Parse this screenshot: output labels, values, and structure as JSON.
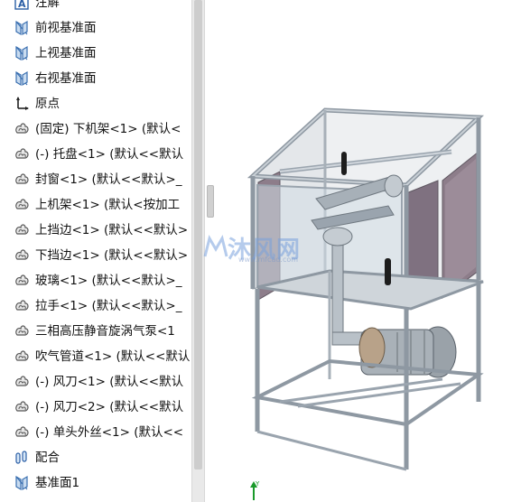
{
  "feature_tree": {
    "items": [
      {
        "icon": "annotations-icon",
        "label": "注解"
      },
      {
        "icon": "plane-icon",
        "label": "前视基准面"
      },
      {
        "icon": "plane-icon",
        "label": "上视基准面"
      },
      {
        "icon": "plane-icon",
        "label": "右视基准面"
      },
      {
        "icon": "origin-icon",
        "label": "原点"
      },
      {
        "icon": "part-icon",
        "label": "(固定) 下机架<1> (默认<"
      },
      {
        "icon": "part-icon",
        "label": "(-) 托盘<1> (默认<<默认"
      },
      {
        "icon": "part-icon",
        "label": "封窗<1> (默认<<默认>_"
      },
      {
        "icon": "part-icon",
        "label": "上机架<1> (默认<按加工"
      },
      {
        "icon": "part-icon",
        "label": "上挡边<1> (默认<<默认>"
      },
      {
        "icon": "part-icon",
        "label": "下挡边<1> (默认<<默认>"
      },
      {
        "icon": "part-icon",
        "label": "玻璃<1> (默认<<默认>_"
      },
      {
        "icon": "part-icon",
        "label": "拉手<1> (默认<<默认>_"
      },
      {
        "icon": "part-icon",
        "label": "三相高压静音旋涡气泵<1"
      },
      {
        "icon": "part-icon",
        "label": "吹气管道<1> (默认<<默认"
      },
      {
        "icon": "part-icon",
        "label": "(-) 风刀<1> (默认<<默认"
      },
      {
        "icon": "part-icon",
        "label": "(-) 风刀<2> (默认<<默认"
      },
      {
        "icon": "part-icon",
        "label": "(-) 单头外丝<1> (默认<<"
      },
      {
        "icon": "mates-icon",
        "label": "配合"
      },
      {
        "icon": "plane-icon",
        "label": "基准面1"
      }
    ]
  },
  "watermark": {
    "text": "沐风网",
    "url": "www.mfcad.com"
  },
  "colors": {
    "accent": "#3a78c3",
    "frame": "#a9b3bd",
    "panel": "#8a7a86"
  }
}
